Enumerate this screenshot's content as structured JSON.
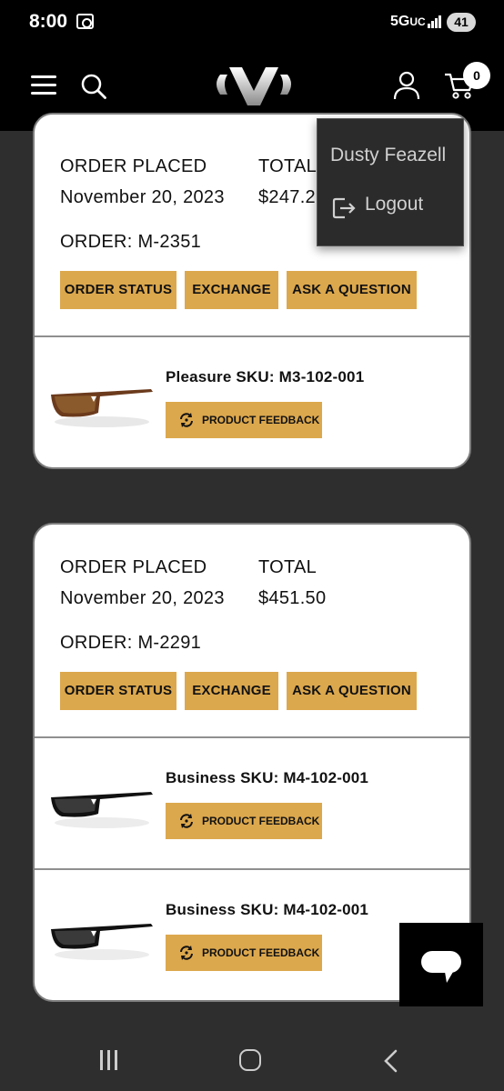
{
  "status_bar": {
    "time": "8:00",
    "network": "5G",
    "network_suffix": "UC",
    "battery": "41"
  },
  "header": {
    "cart_count": "0"
  },
  "user_menu": {
    "name": "Dusty Feazell",
    "logout_label": "Logout"
  },
  "labels": {
    "order_placed": "ORDER PLACED",
    "total": "TOTAL",
    "order_prefix": "ORDER: ",
    "order_status": "ORDER STATUS",
    "exchange": "EXCHANGE",
    "ask_question": "ASK A QUESTION",
    "product_feedback": "PRODUCT FEEDBACK"
  },
  "orders": [
    {
      "date": "November 20, 2023",
      "total": "$247.2",
      "order_line": "ORDER: M-2351",
      "products": [
        {
          "sku_line": "Pleasure SKU: M3-102-001",
          "frame_color": "#6b3a1c"
        }
      ]
    },
    {
      "date": "November 20, 2023",
      "total": "$451.50",
      "order_line": "ORDER: M-2291",
      "products": [
        {
          "sku_line": "Business SKU: M4-102-001",
          "frame_color": "#111111"
        },
        {
          "sku_line": "Business SKU: M4-102-001",
          "frame_color": "#111111"
        }
      ]
    }
  ],
  "colors": {
    "accent": "#dca84d",
    "header_bg": "#000000",
    "page_bg": "#2e2e2e"
  }
}
